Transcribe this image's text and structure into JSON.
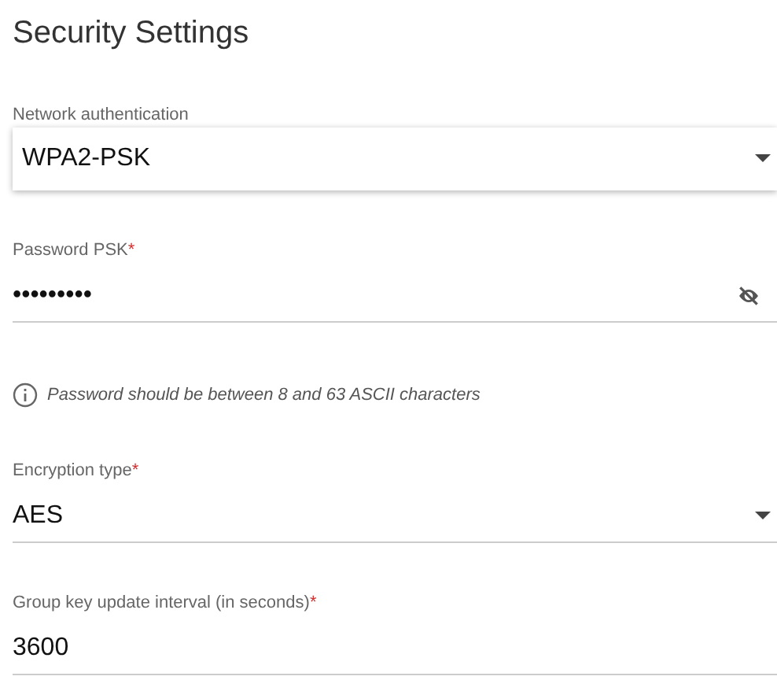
{
  "title": "Security Settings",
  "fields": [
    {
      "kind": "select",
      "label": "Network authentication",
      "value": "WPA2-PSK",
      "focused": true
    },
    {
      "kind": "password",
      "label": "Password PSK",
      "required_mark": "*",
      "value": "•••••••••",
      "focused": false
    },
    {
      "kind": "hint",
      "text": "Password should be between 8 and 63 ASCII characters"
    },
    {
      "kind": "select",
      "label": "Encryption type",
      "required_mark": "*",
      "value": "AES",
      "focused": false
    },
    {
      "kind": "text",
      "label": "Group key update interval (in seconds)",
      "required_mark": "*",
      "value": "3600",
      "focused": false
    }
  ]
}
